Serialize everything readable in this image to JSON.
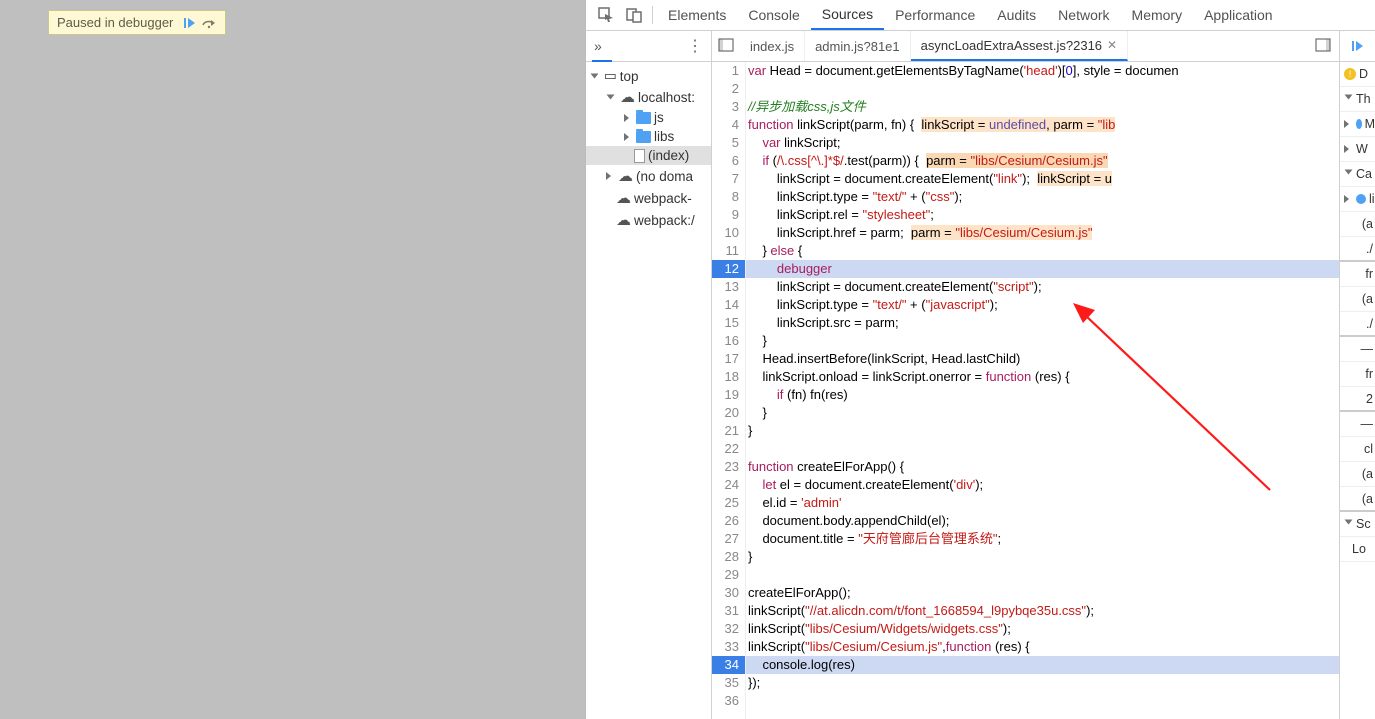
{
  "debug_paused": {
    "label": "Paused in debugger"
  },
  "header_tabs": [
    "Elements",
    "Console",
    "Sources",
    "Performance",
    "Audits",
    "Network",
    "Memory",
    "Application"
  ],
  "header_active": 2,
  "file_tree": {
    "top": "top",
    "host": "localhost:",
    "folders": [
      "js",
      "libs"
    ],
    "index": "(index)",
    "no_domain": "(no doma",
    "wp1": "webpack-",
    "wp2": "webpack:/"
  },
  "open_files": {
    "f0": "index.js",
    "f1": "admin.js?81e1",
    "f2": "asyncLoadExtraAssest.js?2316"
  },
  "code_lines": [
    {
      "n": 1,
      "html": "<span class='s-kw'>var</span> Head = document.getElementsByTagName(<span class='s-str'>'head'</span>)[<span class='s-num'>0</span>], style = documen"
    },
    {
      "n": 2,
      "html": ""
    },
    {
      "n": 3,
      "html": "<span class='s-cm'>//异步加载css,js文件</span>"
    },
    {
      "n": 4,
      "html": "<span class='s-kw'>function</span> linkScript(parm, fn) {  <span class='s-hint'>linkScript = <span class='s-prop'>undefined</span>, parm = <span class='s-str'>\"lib</span></span>"
    },
    {
      "n": 5,
      "html": "    <span class='s-kw'>var</span> linkScript;"
    },
    {
      "n": 6,
      "html": "    <span class='s-kw'>if</span> (<span class='s-str'>/\\.css[^\\.]*$/</span>.test(parm)) {  <span class='s-hint2'>parm = <span class='s-str'>\"libs/Cesium/Cesium.js\"</span></span>"
    },
    {
      "n": 7,
      "html": "        linkScript = document.createElement(<span class='s-str'>\"link\"</span>);  <span class='s-hint'>linkScript = u</span>"
    },
    {
      "n": 8,
      "html": "        linkScript.type = <span class='s-str'>\"text/\"</span> + (<span class='s-str'>\"css\"</span>);"
    },
    {
      "n": 9,
      "html": "        linkScript.rel = <span class='s-str'>\"stylesheet\"</span>;"
    },
    {
      "n": 10,
      "html": "        linkScript.href = parm;  <span class='s-hint'>parm = <span class='s-str'>\"libs/Cesium/Cesium.js\"</span></span>"
    },
    {
      "n": 11,
      "html": "    } <span class='s-kw'>else</span> {"
    },
    {
      "n": 12,
      "exec": true,
      "html": "        <span class='s-kw'>debugger</span>"
    },
    {
      "n": 13,
      "html": "        linkScript = document.createElement(<span class='s-str'>\"script\"</span>);"
    },
    {
      "n": 14,
      "html": "        linkScript.type = <span class='s-str'>\"text/\"</span> + (<span class='s-str'>\"javascript\"</span>);"
    },
    {
      "n": 15,
      "html": "        linkScript.src = parm;"
    },
    {
      "n": 16,
      "html": "    }"
    },
    {
      "n": 17,
      "html": "    Head.insertBefore(linkScript, Head.lastChild)"
    },
    {
      "n": 18,
      "html": "    linkScript.onload = linkScript.onerror = <span class='s-kw'>function</span> (res) {"
    },
    {
      "n": 19,
      "html": "        <span class='s-kw'>if</span> (fn) fn(res)"
    },
    {
      "n": 20,
      "html": "    }"
    },
    {
      "n": 21,
      "html": "}"
    },
    {
      "n": 22,
      "html": ""
    },
    {
      "n": 23,
      "html": "<span class='s-kw'>function</span> createElForApp() {"
    },
    {
      "n": 24,
      "html": "    <span class='s-kw'>let</span> el = document.createElement(<span class='s-str'>'div'</span>);"
    },
    {
      "n": 25,
      "html": "    el.id = <span class='s-str'>'admin'</span>"
    },
    {
      "n": 26,
      "html": "    document.body.appendChild(el);"
    },
    {
      "n": 27,
      "html": "    document.title = <span class='s-str'>\"天府管廊后台管理系统\"</span>;"
    },
    {
      "n": 28,
      "html": "}"
    },
    {
      "n": 29,
      "html": ""
    },
    {
      "n": 30,
      "html": "createElForApp();"
    },
    {
      "n": 31,
      "html": "linkScript(<span class='s-str'>\"//at.alicdn.com/t/font_1668594_l9pybqe35u.css\"</span>);"
    },
    {
      "n": 32,
      "html": "linkScript(<span class='s-str'>\"libs/Cesium/Widgets/widgets.css\"</span>);"
    },
    {
      "n": 33,
      "html": "linkScript(<span class='s-str'>\"libs/Cesium/Cesium.js\"</span>,<span class='s-kw'>function</span> (res) {"
    },
    {
      "n": 34,
      "exec": true,
      "html": "    console.log(res)"
    },
    {
      "n": 35,
      "html": "});"
    },
    {
      "n": 36,
      "html": ""
    }
  ],
  "side_labels": {
    "d": "D",
    "t": "Th",
    "m": "M",
    "w": "W",
    "ca": "Ca",
    "li": "li",
    "a1": "(a",
    "dot": "./",
    "fr": "fr",
    "a2": "(a",
    "dot2": "./",
    "dash": "—",
    "fr2": "fr",
    "two": "2",
    "dash2": "—",
    "cl": "cl",
    "a3": "(a",
    "a4": "(a",
    "sc": "Sc",
    "lo": "Lo"
  }
}
